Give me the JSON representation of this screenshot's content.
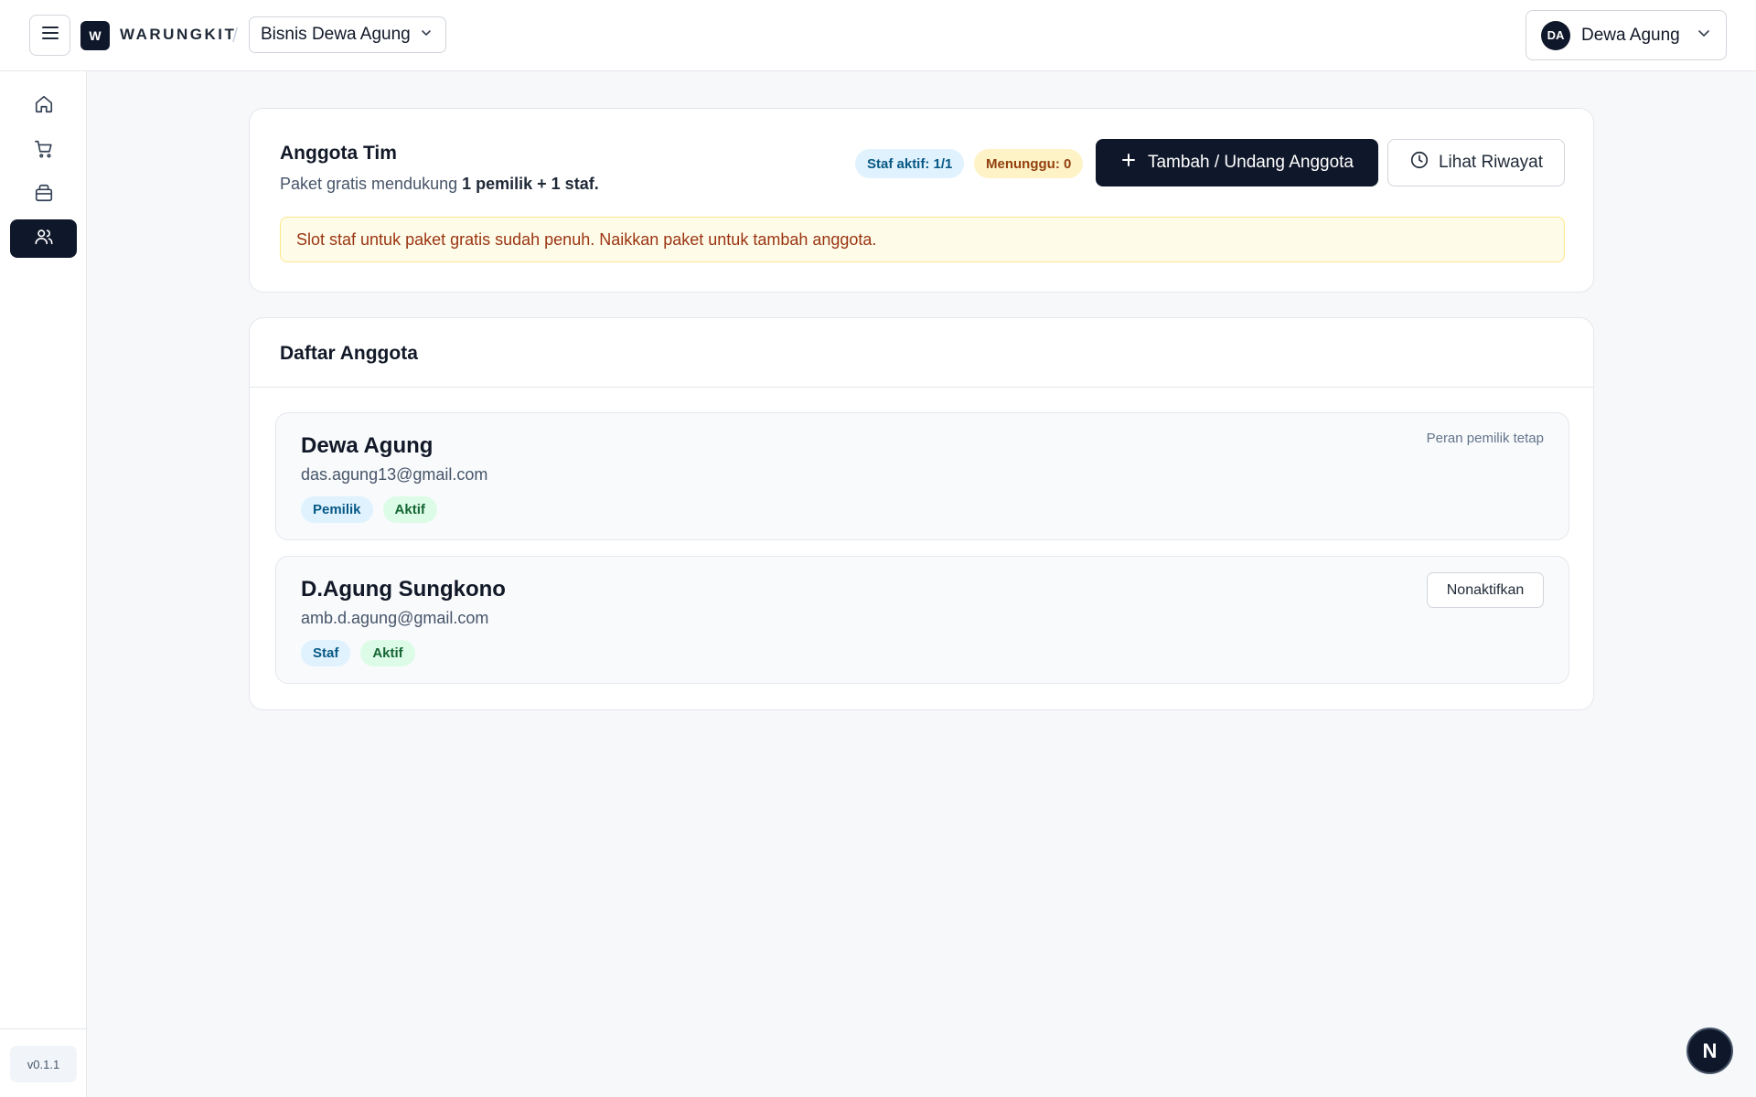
{
  "header": {
    "logo_letter": "W",
    "brand": "WARUNGKIT",
    "separator": "/",
    "business": "Bisnis Dewa Agung",
    "user_initials": "DA",
    "user_name": "Dewa Agung"
  },
  "sidebar": {
    "items": [
      {
        "icon": "home-icon"
      },
      {
        "icon": "cart-icon"
      },
      {
        "icon": "store-icon"
      },
      {
        "icon": "users-icon",
        "active": true
      }
    ],
    "version": "v0.1.1"
  },
  "team": {
    "title": "Anggota Tim",
    "subtitle_prefix": "Paket gratis mendukung ",
    "subtitle_bold": "1 pemilik + 1 staf.",
    "staff_chip": "Staf aktif: 1/1",
    "waiting_chip": "Menunggu: 0",
    "add_button": "Tambah / Undang Anggota",
    "history_button": "Lihat Riwayat",
    "alert": "Slot staf untuk paket gratis sudah penuh. Naikkan paket untuk tambah anggota."
  },
  "members_list": {
    "title": "Daftar Anggota",
    "members": [
      {
        "name": "Dewa Agung",
        "email": "das.agung13@gmail.com",
        "role": "Pemilik",
        "status": "Aktif",
        "note": "Peran pemilik tetap"
      },
      {
        "name": "D.Agung Sungkono",
        "email": "amb.d.agung@gmail.com",
        "role": "Staf",
        "status": "Aktif",
        "action": "Nonaktifkan"
      }
    ]
  },
  "fab_label": "N",
  "colors": {
    "primary": "#0f172a",
    "alert_bg": "#fefce8",
    "alert_text": "#9a3412",
    "chip_blue": "#e0f2fe",
    "chip_amber": "#fef3c7",
    "chip_green": "#dcfce7"
  }
}
